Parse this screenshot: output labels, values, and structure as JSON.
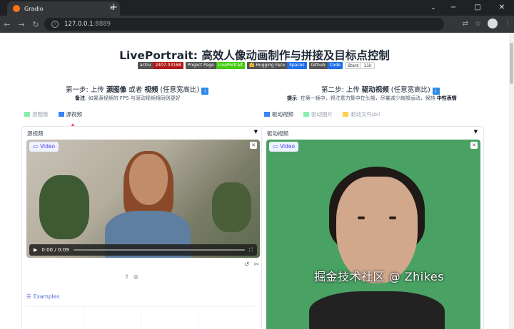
{
  "browser": {
    "tab_title": "Gradio",
    "tab_close": "×",
    "new_tab": "+",
    "url_host": "127.0.0.1",
    "url_port": ":8889",
    "window_controls": [
      "⌄",
      "−",
      "□",
      "✕"
    ]
  },
  "page": {
    "title": "LivePortrait: 高效人像动画制作与拼接及目标点控制",
    "badges": [
      {
        "left": "arXiv",
        "right": "2407.03168",
        "left_color": "#555555",
        "right_color": "#b31b1b"
      },
      {
        "left": "Project Page",
        "right": "LivePortrait",
        "left_color": "#555555",
        "right_color": "#4c1"
      },
      {
        "left": "🤗 Hugging Face",
        "right": "Spaces",
        "left_color": "#555555",
        "right_color": "#1f6feb"
      },
      {
        "left": "Github",
        "right": "Code",
        "left_color": "#555555",
        "right_color": "#1f6feb"
      },
      {
        "left": "Stars",
        "right": "11k",
        "left_color": "#f6f8fa",
        "right_color": "#ffffff"
      }
    ]
  },
  "left": {
    "step_pre": "第一步: 上传 ",
    "step_b1": "源图像",
    "step_mid": " 或者 ",
    "step_b2": "视频",
    "step_post": " (任意宽高比) ",
    "note_label": "备注",
    "note_text": ": 如果源视频的 FPS 与驱动视频相同则更好",
    "tabs": [
      "源图像",
      "源视频"
    ],
    "panel_label": "源视频",
    "video_label": "Video",
    "time": "0:00 / 0:09",
    "examples": "Examples"
  },
  "right": {
    "step_pre": "第二步: 上传 ",
    "step_b1": "驱动视频",
    "step_post": " (任意宽高比) ",
    "tip_label": "提示",
    "tip_text": ": 在第一帧中，将注意力集中在头部，尽量减少肩部运动，保持 ",
    "tip_bold": "中性表情",
    "tabs": [
      "驱动视频",
      "驱动图片",
      "驱动文件pkl"
    ],
    "panel_label": "驱动视频",
    "video_label": "Video"
  },
  "watermark": "掘金技术社区 @ Zhikes"
}
